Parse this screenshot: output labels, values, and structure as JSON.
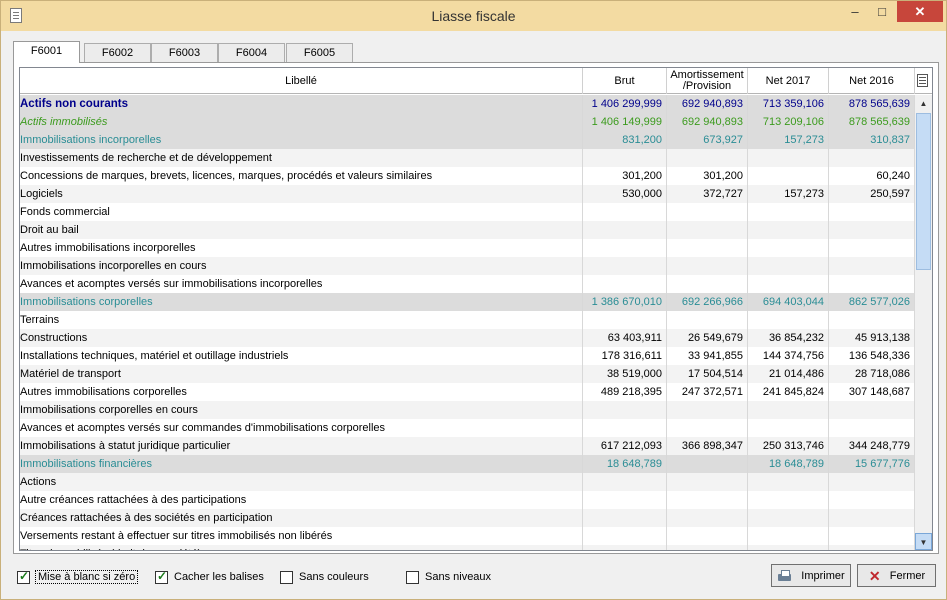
{
  "window": {
    "title": "Liasse fiscale",
    "minimize": "‒",
    "maximize": "□",
    "close": "✕"
  },
  "tabs": [
    "F6001",
    "F6002",
    "F6003",
    "F6004",
    "F6005"
  ],
  "columns": {
    "label": "Libellé",
    "brut": "Brut",
    "amort_line1": "Amortissement",
    "amort_line2": "/Provision",
    "net2017": "Net 2017",
    "net2016": "Net 2016"
  },
  "rows": [
    {
      "level": 0,
      "label": "Actifs non courants",
      "brut": "1 406 299,999",
      "amort": "692 940,893",
      "net2017": "713 359,106",
      "net2016": "878 565,639"
    },
    {
      "level": 1,
      "label": "Actifs immobilisés",
      "brut": "1 406 149,999",
      "amort": "692 940,893",
      "net2017": "713 209,106",
      "net2016": "878 565,639"
    },
    {
      "level": 2,
      "label": "Immobilisations incorporelles",
      "brut": "831,200",
      "amort": "673,927",
      "net2017": "157,273",
      "net2016": "310,837"
    },
    {
      "level": 3,
      "label": "Investissements de recherche et de développement",
      "brut": "",
      "amort": "",
      "net2017": "",
      "net2016": ""
    },
    {
      "level": 3,
      "label": "Concessions de marques, brevets, licences, marques, procédés et valeurs similaires",
      "brut": "301,200",
      "amort": "301,200",
      "net2017": "",
      "net2016": "60,240"
    },
    {
      "level": 3,
      "label": "Logiciels",
      "brut": "530,000",
      "amort": "372,727",
      "net2017": "157,273",
      "net2016": "250,597"
    },
    {
      "level": 3,
      "label": "Fonds commercial",
      "brut": "",
      "amort": "",
      "net2017": "",
      "net2016": ""
    },
    {
      "level": 3,
      "label": "Droit au bail",
      "brut": "",
      "amort": "",
      "net2017": "",
      "net2016": ""
    },
    {
      "level": 3,
      "label": "Autres immobilisations incorporelles",
      "brut": "",
      "amort": "",
      "net2017": "",
      "net2016": ""
    },
    {
      "level": 3,
      "label": "Immobilisations incorporelles en cours",
      "brut": "",
      "amort": "",
      "net2017": "",
      "net2016": ""
    },
    {
      "level": 3,
      "label": "Avances et acomptes versés sur immobilisations incorporelles",
      "brut": "",
      "amort": "",
      "net2017": "",
      "net2016": ""
    },
    {
      "level": 2,
      "label": "Immobilisations corporelles",
      "brut": "1 386 670,010",
      "amort": "692 266,966",
      "net2017": "694 403,044",
      "net2016": "862 577,026"
    },
    {
      "level": 3,
      "label": "Terrains",
      "brut": "",
      "amort": "",
      "net2017": "",
      "net2016": ""
    },
    {
      "level": 3,
      "label": "Constructions",
      "brut": "63 403,911",
      "amort": "26 549,679",
      "net2017": "36 854,232",
      "net2016": "45 913,138"
    },
    {
      "level": 3,
      "label": "Installations techniques, matériel et outillage industriels",
      "brut": "178 316,611",
      "amort": "33 941,855",
      "net2017": "144 374,756",
      "net2016": "136 548,336"
    },
    {
      "level": 3,
      "label": "Matériel de transport",
      "brut": "38 519,000",
      "amort": "17 504,514",
      "net2017": "21 014,486",
      "net2016": "28 718,086"
    },
    {
      "level": 3,
      "label": "Autres immobilisations corporelles",
      "brut": "489 218,395",
      "amort": "247 372,571",
      "net2017": "241 845,824",
      "net2016": "307 148,687"
    },
    {
      "level": 3,
      "label": "Immobilisations corporelles en cours",
      "brut": "",
      "amort": "",
      "net2017": "",
      "net2016": ""
    },
    {
      "level": 3,
      "label": "Avances et acomptes versés sur commandes d'immobilisations corporelles",
      "brut": "",
      "amort": "",
      "net2017": "",
      "net2016": ""
    },
    {
      "level": 3,
      "label": "Immobilisations à statut juridique particulier",
      "brut": "617 212,093",
      "amort": "366 898,347",
      "net2017": "250 313,746",
      "net2016": "344 248,779"
    },
    {
      "level": 2,
      "label": "Immobilisations financières",
      "brut": "18 648,789",
      "amort": "",
      "net2017": "18 648,789",
      "net2016": "15 677,776"
    },
    {
      "level": 3,
      "label": "Actions",
      "brut": "",
      "amort": "",
      "net2017": "",
      "net2016": ""
    },
    {
      "level": 3,
      "label": "Autre créances rattachées à des participations",
      "brut": "",
      "amort": "",
      "net2017": "",
      "net2016": ""
    },
    {
      "level": 3,
      "label": "Créances rattachées à des sociétés en participation",
      "brut": "",
      "amort": "",
      "net2017": "",
      "net2016": ""
    },
    {
      "level": 3,
      "label": "Versements restant à effectuer sur titres immobilisés non libérés",
      "brut": "",
      "amort": "",
      "net2017": "",
      "net2016": ""
    },
    {
      "level": 3,
      "label": "Titres immobilisés (droit de propriété)",
      "brut": "",
      "amort": "",
      "net2017": "",
      "net2016": ""
    }
  ],
  "options": [
    {
      "label": "Mise à blanc si zéro",
      "checked": true
    },
    {
      "label": "Cacher les balises",
      "checked": true
    },
    {
      "label": "Sans couleurs",
      "checked": false
    },
    {
      "label": "Sans niveaux",
      "checked": false
    }
  ],
  "buttons": {
    "print": "Imprimer",
    "close": "Fermer"
  },
  "icons": {
    "app": "document-icon",
    "columns": "column-config-icon",
    "print": "printer-icon",
    "close": "close-x-icon"
  },
  "colors": {
    "level0": "#00008b",
    "level1": "#3c9b1e",
    "level2": "#2a8d95",
    "titlebar": "#f3dba2",
    "close_button": "#c7463b"
  }
}
